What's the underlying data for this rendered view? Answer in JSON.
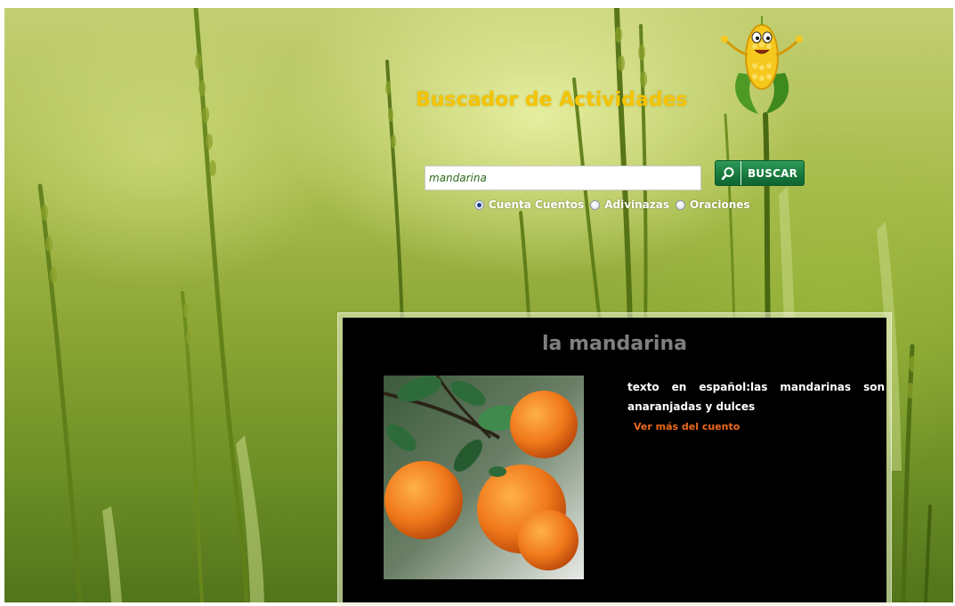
{
  "header": {
    "title": "Buscador de Actividades"
  },
  "search": {
    "value": "mandarina",
    "button_label": "BUSCAR",
    "button_icon": "search-icon"
  },
  "categories": [
    {
      "label": "Cuenta Cuentos",
      "checked": true
    },
    {
      "label": "Adivinazas",
      "checked": false
    },
    {
      "label": "Oraciones",
      "checked": false
    }
  ],
  "result": {
    "title": "la mandarina",
    "text": "texto en español:las mandarinas son anaranjadas y dulces",
    "link_label": "Ver más del cuento",
    "image": "mandarin-oranges-photo"
  },
  "colors": {
    "title": "#f5c400",
    "button": "#177a3e",
    "link": "#ee6a1c",
    "card_bg": "#000000"
  }
}
